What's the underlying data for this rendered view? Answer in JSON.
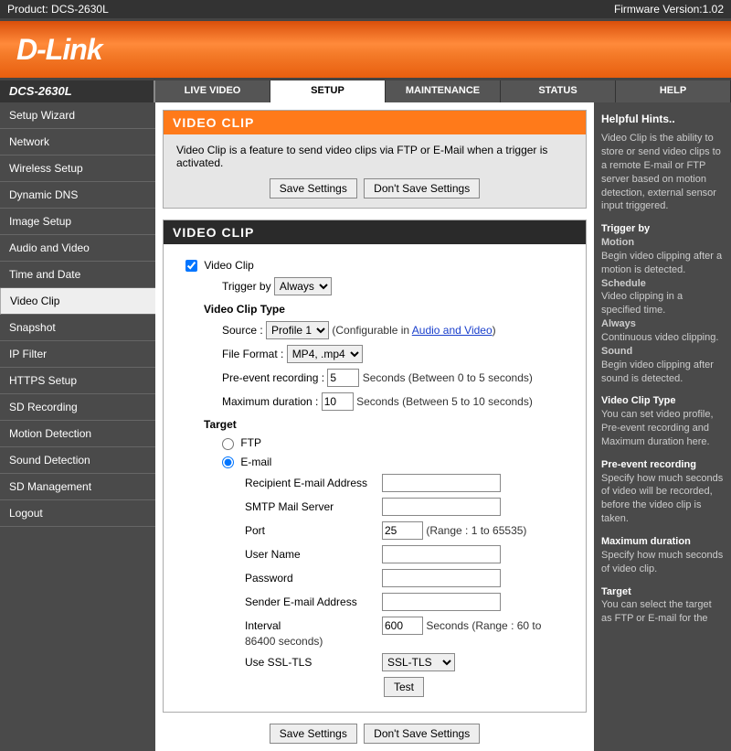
{
  "topbar": {
    "product_label": "Product:",
    "product": "DCS-2630L",
    "fw_label": "Firmware Version:",
    "fw": "1.02"
  },
  "logo": "D-Link",
  "model": "DCS-2630L",
  "tabs": [
    "LIVE VIDEO",
    "SETUP",
    "MAINTENANCE",
    "STATUS",
    "HELP"
  ],
  "sidebar": [
    "Setup Wizard",
    "Network",
    "Wireless Setup",
    "Dynamic DNS",
    "Image Setup",
    "Audio and Video",
    "Time and Date",
    "Video Clip",
    "Snapshot",
    "IP Filter",
    "HTTPS Setup",
    "SD Recording",
    "Motion Detection",
    "Sound Detection",
    "SD Management",
    "Logout"
  ],
  "panel1": {
    "header": "VIDEO CLIP",
    "desc": "Video Clip is a feature to send video clips via FTP or E-Mail when a trigger is activated.",
    "save": "Save Settings",
    "dont": "Don't Save Settings"
  },
  "panel2": {
    "header": "VIDEO CLIP",
    "enable_label": "Video Clip",
    "trigger_label": "Trigger by",
    "trigger_value": "Always",
    "type_h": "Video Clip Type",
    "source_label": "Source :",
    "source_value": "Profile 1",
    "source_hint1": "(Configurable in ",
    "source_link": "Audio and Video",
    "source_hint2": ")",
    "format_label": "File Format :",
    "format_value": "MP4, .mp4",
    "pre_label": "Pre-event recording :",
    "pre_value": "5",
    "pre_hint": "Seconds  (Between 0 to 5 seconds)",
    "max_label": "Maximum duration :",
    "max_value": "10",
    "max_hint": "Seconds  (Between 5 to 10 seconds)",
    "target_h": "Target",
    "ftp": "FTP",
    "email": "E-mail",
    "recip": "Recipient E-mail Address",
    "smtp": "SMTP Mail Server",
    "port_l": "Port",
    "port_v": "25",
    "port_h": "(Range : 1 to 65535)",
    "user": "User Name",
    "pwd": "Password",
    "sender": "Sender E-mail Address",
    "interval_l": "Interval",
    "interval_v": "600",
    "interval_h": "Seconds  (Range : 60 to 86400 seconds)",
    "ssl_l": "Use SSL-TLS",
    "ssl_v": "SSL-TLS",
    "test": "Test"
  },
  "hints": {
    "title": "Helpful Hints..",
    "p1": "Video Clip is the ability to store or send video clips to a remote E-mail or FTP server based on motion detection, external sensor input triggered.",
    "h2": "Trigger by",
    "h2a": "Motion",
    "p2a": "Begin video clipping after a motion is detected.",
    "h2b": "Schedule",
    "p2b": "Video clipping in a specified time.",
    "h2c": "Always",
    "p2c": "Continuous video clipping.",
    "h2d": "Sound",
    "p2d": "Begin video clipping after sound is detected.",
    "h3": "Video Clip Type",
    "p3": "You can set video profile, Pre-event recording and Maximum duration here.",
    "h4": "Pre-event recording",
    "p4": "Specify how much seconds of video will be recorded, before the video clip is taken.",
    "h5": "Maximum duration",
    "p5": "Specify how much seconds of video clip.",
    "h6": "Target",
    "p6": "You can select the target as FTP or E-mail for the"
  }
}
